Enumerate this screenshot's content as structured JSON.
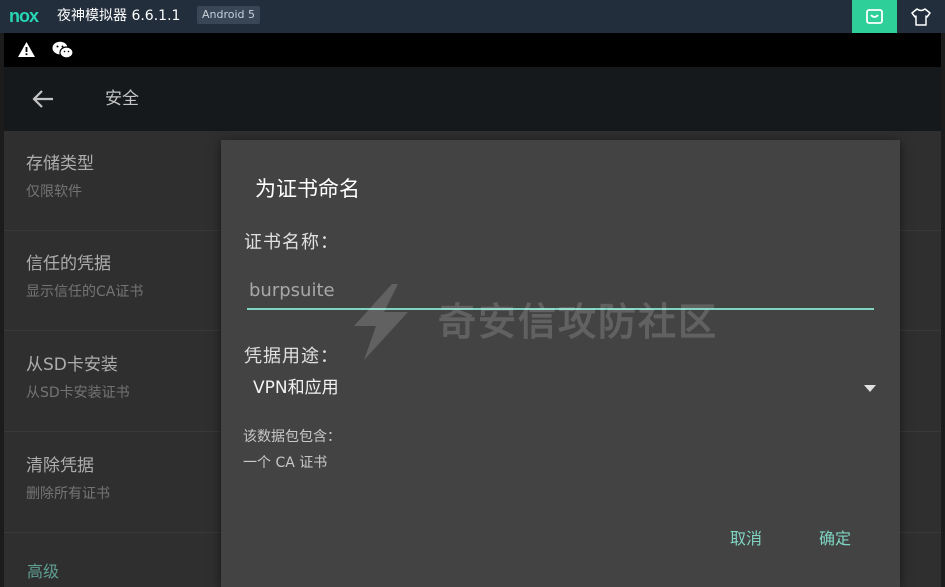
{
  "emulator": {
    "logo_text": "nox",
    "title": "夜神模拟器 6.6.1.1",
    "android_badge": "Android 5",
    "bag_icon": "bag-icon",
    "shirt_icon": "shirt-icon",
    "bag_button_color": "#2ecf98"
  },
  "statusbar": {
    "icons": [
      "warning-icon",
      "wechat-icon"
    ]
  },
  "actionbar": {
    "back_icon": "arrow-left-icon",
    "title": "安全"
  },
  "settings": {
    "items": [
      {
        "title": "存储类型",
        "summary": "仅限软件"
      },
      {
        "title": "信任的凭据",
        "summary": "显示信任的CA证书"
      },
      {
        "title": "从SD卡安装",
        "summary": "从SD卡安装证书"
      },
      {
        "title": "清除凭据",
        "summary": "删除所有证书"
      }
    ],
    "section_header": "高级"
  },
  "dialog": {
    "title": "为证书命名",
    "name_label": "证书名称：",
    "name_value": "burpsuite",
    "usage_label": "凭据用途：",
    "usage_value": "VPN和应用",
    "info_line1": "该数据包包含：",
    "info_line2": "一个 CA 证书",
    "cancel_label": "取消",
    "ok_label": "确定",
    "accent_color": "#7fd4c2"
  },
  "watermark": {
    "text": "奇安信攻防社区"
  }
}
